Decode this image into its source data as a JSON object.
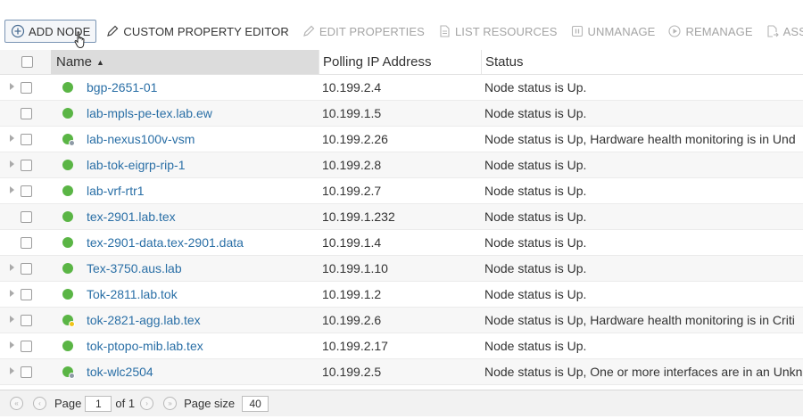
{
  "toolbar": {
    "items": [
      {
        "label": "ADD NODE",
        "icon": "add-circle-icon",
        "state": "enabled"
      },
      {
        "label": "CUSTOM PROPERTY EDITOR",
        "icon": "pencil-icon",
        "state": "enabled"
      },
      {
        "label": "EDIT PROPERTIES",
        "icon": "pencil-icon",
        "state": "disabled"
      },
      {
        "label": "LIST RESOURCES",
        "icon": "document-icon",
        "state": "disabled"
      },
      {
        "label": "UNMANAGE",
        "icon": "pause-icon",
        "state": "disabled"
      },
      {
        "label": "REMANAGE",
        "icon": "play-icon",
        "state": "disabled"
      },
      {
        "label": "ASSIGN POLLER",
        "icon": "assign-icon",
        "state": "disabled"
      }
    ]
  },
  "table": {
    "headers": {
      "name": "Name",
      "ip": "Polling IP Address",
      "status": "Status"
    },
    "rows": [
      {
        "name": "bgp-2651-01",
        "ip": "10.199.2.4",
        "status": "Node status is Up.",
        "badge": "",
        "expander": true
      },
      {
        "name": "lab-mpls-pe-tex.lab.ew",
        "ip": "10.199.1.5",
        "status": "Node status is Up.",
        "badge": "",
        "expander": false
      },
      {
        "name": "lab-nexus100v-vsm",
        "ip": "10.199.2.26",
        "status": "Node status is Up, Hardware health monitoring is in Und",
        "badge": "grey",
        "expander": true
      },
      {
        "name": "lab-tok-eigrp-rip-1",
        "ip": "10.199.2.8",
        "status": "Node status is Up.",
        "badge": "",
        "expander": true
      },
      {
        "name": "lab-vrf-rtr1",
        "ip": "10.199.2.7",
        "status": "Node status is Up.",
        "badge": "",
        "expander": true
      },
      {
        "name": "tex-2901.lab.tex",
        "ip": "10.199.1.232",
        "status": "Node status is Up.",
        "badge": "",
        "expander": false
      },
      {
        "name": "tex-2901-data.tex-2901.data",
        "ip": "10.199.1.4",
        "status": "Node status is Up.",
        "badge": "",
        "expander": false
      },
      {
        "name": "Tex-3750.aus.lab",
        "ip": "10.199.1.10",
        "status": "Node status is Up.",
        "badge": "",
        "expander": true
      },
      {
        "name": "Tok-2811.lab.tok",
        "ip": "10.199.1.2",
        "status": "Node status is Up.",
        "badge": "",
        "expander": true
      },
      {
        "name": "tok-2821-agg.lab.tex",
        "ip": "10.199.2.6",
        "status": "Node status is Up, Hardware health monitoring is in Criti",
        "badge": "yellow",
        "expander": true
      },
      {
        "name": "tok-ptopo-mib.lab.tex",
        "ip": "10.199.2.17",
        "status": "Node status is Up.",
        "badge": "",
        "expander": true
      },
      {
        "name": "tok-wlc2504",
        "ip": "10.199.2.5",
        "status": "Node status is Up, One or more interfaces are in an Unkn",
        "badge": "grey",
        "expander": true
      }
    ]
  },
  "pager": {
    "page_label": "Page",
    "page_value": "1",
    "of_label": "of 1",
    "page_size_label": "Page size",
    "page_size_value": "40"
  },
  "colors": {
    "status_up": "#5ab545",
    "link": "#2a6fa6",
    "badge_grey": "#8e9aa6",
    "badge_yellow": "#f0c419"
  }
}
